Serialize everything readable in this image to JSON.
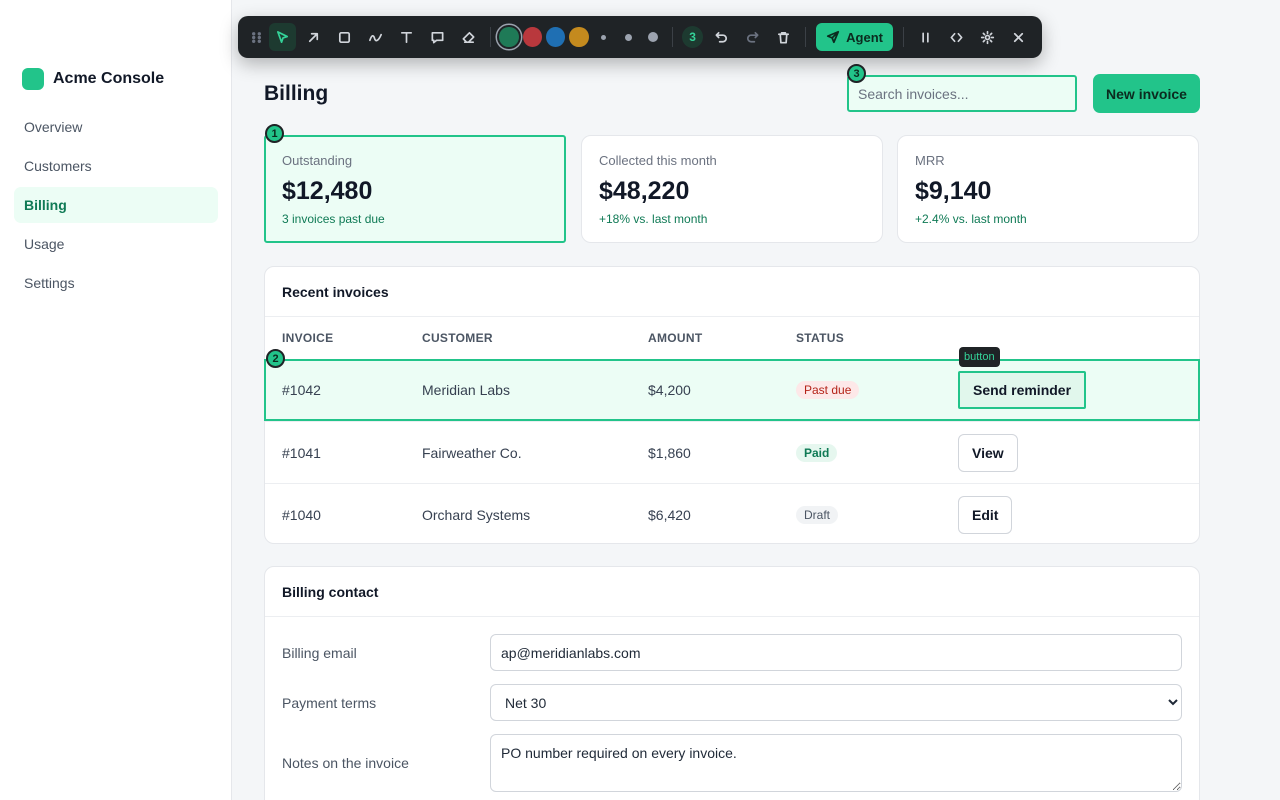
{
  "app": {
    "name": "Acme Console"
  },
  "sidebar": {
    "items": [
      {
        "label": "Overview"
      },
      {
        "label": "Customers"
      },
      {
        "label": "Billing"
      },
      {
        "label": "Usage"
      },
      {
        "label": "Settings"
      }
    ],
    "active": "Billing"
  },
  "toolbar": {
    "tools": [
      "drag-handle",
      "select",
      "arrow",
      "rectangle",
      "freehand",
      "text",
      "comment",
      "eraser"
    ],
    "colors": [
      "#1f7a57",
      "#b9383d",
      "#1f6fb3",
      "#c48a1e"
    ],
    "annotation_count": "3",
    "agent_label": "Agent"
  },
  "header": {
    "title": "Billing",
    "search_placeholder": "Search invoices...",
    "new_button": "New invoice"
  },
  "markers": {
    "m1": "1",
    "m2": "2",
    "m3": "3"
  },
  "stats": [
    {
      "label": "Outstanding",
      "value": "$12,480",
      "sub": "3 invoices past due"
    },
    {
      "label": "Collected this month",
      "value": "$48,220",
      "sub": "+18% vs. last month"
    },
    {
      "label": "MRR",
      "value": "$9,140",
      "sub": "+2.4% vs. last month"
    }
  ],
  "invoices": {
    "title": "Recent invoices",
    "columns": [
      "INVOICE",
      "CUSTOMER",
      "AMOUNT",
      "STATUS"
    ],
    "tooltip": "button",
    "rows": [
      {
        "id": "#1042",
        "customer": "Meridian Labs",
        "amount": "$4,200",
        "status": "Past due",
        "action": "Send reminder"
      },
      {
        "id": "#1041",
        "customer": "Fairweather Co.",
        "amount": "$1,860",
        "status": "Paid",
        "action": "View"
      },
      {
        "id": "#1040",
        "customer": "Orchard Systems",
        "amount": "$6,420",
        "status": "Draft",
        "action": "Edit"
      }
    ]
  },
  "contact": {
    "title": "Billing contact",
    "email_label": "Billing email",
    "email_value": "ap@meridianlabs.com",
    "terms_label": "Payment terms",
    "terms_value": "Net 30",
    "notes_label": "Notes on the invoice",
    "notes_value": "PO number required on every invoice."
  }
}
